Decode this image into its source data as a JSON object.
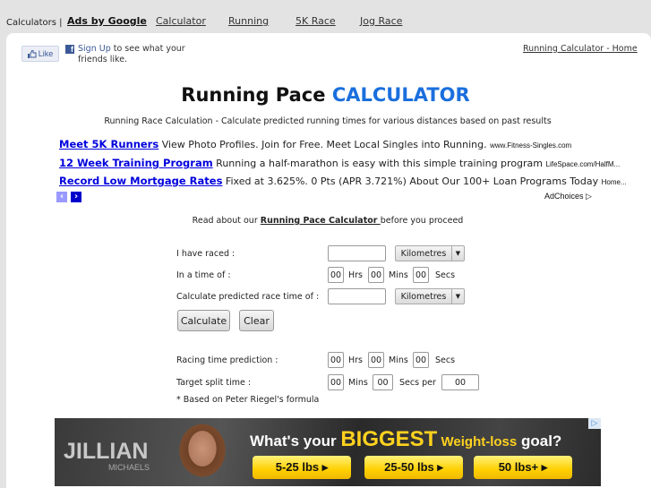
{
  "topbar": {
    "calculators_label": "Calculators |",
    "ads_label": "Ads by Google",
    "links": [
      "Calculator",
      "Running",
      "5K Race",
      "Jog Race"
    ]
  },
  "facebook": {
    "like_label": "Like",
    "signup_label": "Sign Up",
    "signup_text": " to see what your friends like."
  },
  "home_link": "Running Calculator - Home",
  "header": {
    "title_main": "Running Pace ",
    "title_accent": "CALCULATOR",
    "accent_color": "#1a6fdd",
    "subtitle": "Running Race Calculation - Calculate predicted running times for various distances based on past results"
  },
  "ads": {
    "items": [
      {
        "headline": "Meet 5K Runners",
        "text": " View Photo Profiles. Join for Free. Meet Local Singles into Running. ",
        "url": "www.Fitness-Singles.com"
      },
      {
        "headline": "12 Week Training Program",
        "text": " Running a half-marathon is easy with this simple training program ",
        "url": "LifeSpace.com/HalfM..."
      },
      {
        "headline": "Record Low Mortgage Rates",
        "text": " Fixed at 3.625%. 0 Pts (APR 3.721%) About Our 100+ Loan Programs Today ",
        "url": "Home..."
      }
    ],
    "prev_icon": "‹",
    "next_icon": "›",
    "adchoices_label": "AdChoices ▷"
  },
  "intro": {
    "before": "Read about our ",
    "link": "Running Pace Calculator ",
    "after": "before you proceed"
  },
  "form": {
    "raced_label": "I have raced :",
    "raced_value": "",
    "raced_unit": "Kilometres",
    "time_label": "In a time of :",
    "time_hrs": "00",
    "time_mins": "00",
    "time_secs": "00",
    "hrs_label": "Hrs",
    "mins_label": "Mins",
    "secs_label": "Secs",
    "predict_label": "Calculate predicted race time of :",
    "predict_value": "",
    "predict_unit": "Kilometres",
    "calculate_button": "Calculate",
    "clear_button": "Clear"
  },
  "results": {
    "prediction_label": "Racing time prediction :",
    "pred_hrs": "00",
    "pred_mins": "00",
    "pred_secs": "00",
    "split_label": "Target split time :",
    "split_mins": "00",
    "split_secs": "00",
    "secs_per_label": "Secs per",
    "split_per": "00",
    "footnote": "* Based on Peter Riegel's formula"
  },
  "banner": {
    "brand": "JILLIAN",
    "brand_sub": "MICHAELS",
    "headline_pre": "What's your ",
    "headline_big": "BIGGEST",
    "headline_wl": " Weight-loss",
    "headline_post": " goal?",
    "buttons": [
      "5-25 lbs ▸",
      "25-50 lbs ▸",
      "50 lbs+ ▸"
    ],
    "ad_icon": "▷"
  }
}
